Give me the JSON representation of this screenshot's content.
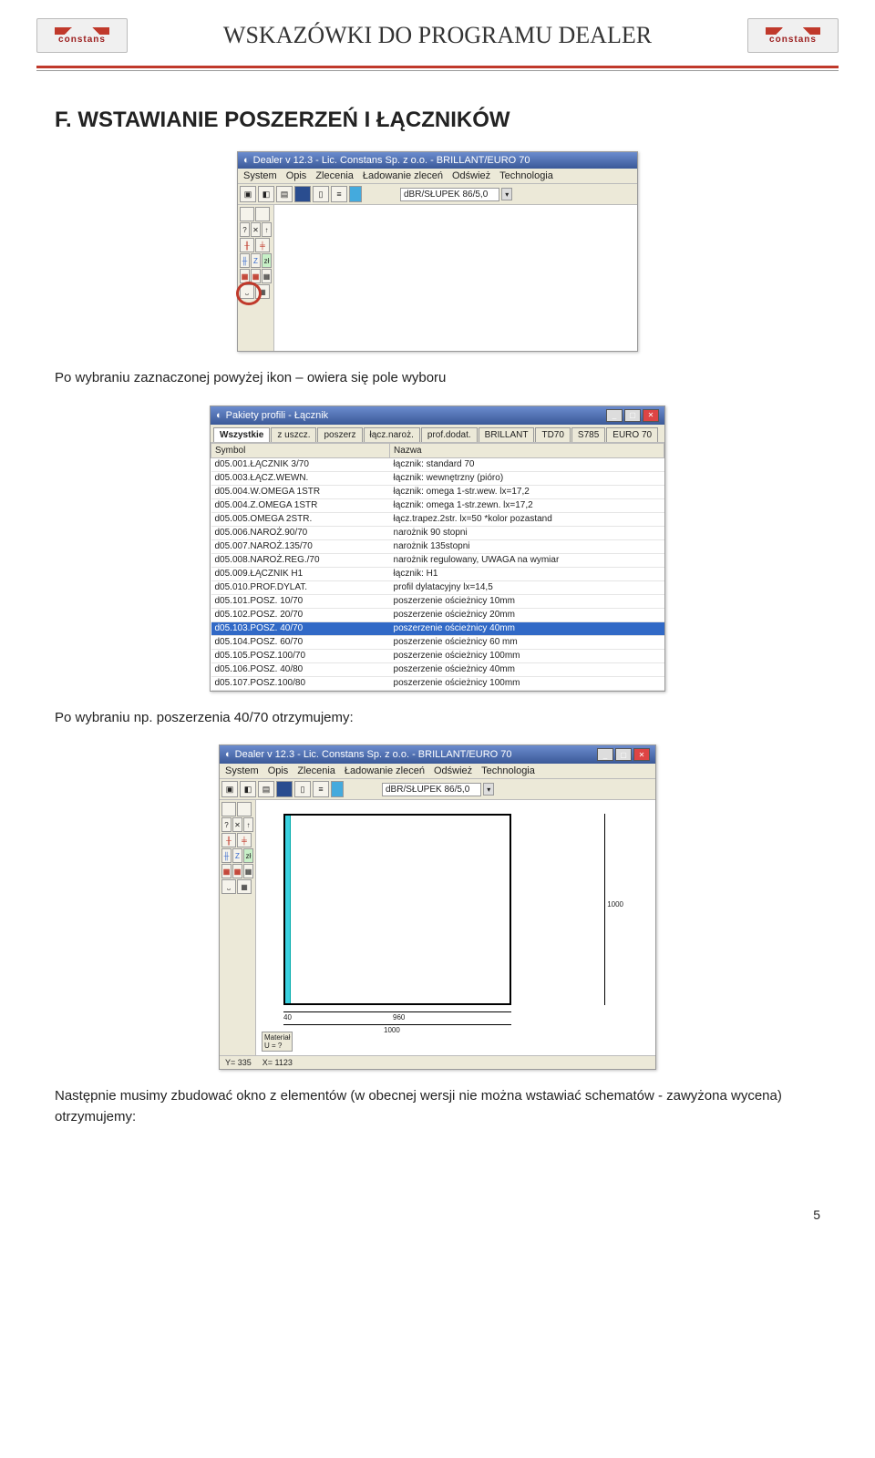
{
  "doc": {
    "header_title": "WSKAZÓWKI DO PROGRAMU DEALER",
    "logo_text": "constans"
  },
  "section": {
    "heading": "F.  WSTAWIANIE POSZERZEŃ I ŁĄCZNIKÓW",
    "para1": "Po wybraniu zaznaczonej powyżej ikon – owiera się pole wyboru",
    "para2": "Po wybraniu np. poszerzenia 40/70 otrzymujemy:",
    "para3": "Następnie musimy zbudować okno z elementów (w obecnej wersji nie można wstawiać schematów - zawyżona wycena) otrzymujemy:"
  },
  "ss_title": "Dealer v 12.3 - Lic. Constans  Sp. z o.o. - BRILLANT/EURO 70",
  "ss_menu": [
    "System",
    "Opis",
    "Zlecenia",
    "Ładowanie zleceń",
    "Odśwież",
    "Technologia"
  ],
  "ss_select": "dBR/SŁUPEK 86/5,0",
  "ss2_title": "Pakiety profili - Łącznik",
  "ss2_tabs": [
    "Wszystkie",
    "z uszcz.",
    "poszerz",
    "łącz.naroż.",
    "prof.dodat.",
    "BRILLANT",
    "TD70",
    "S785",
    "EURO 70"
  ],
  "ss2_headers": [
    "Symbol",
    "Nazwa"
  ],
  "ss2_rows": [
    {
      "sym": "d05.001.ŁĄCZNIK 3/70",
      "naz": "łącznik: standard 70"
    },
    {
      "sym": "d05.003.ŁĄCZ.WEWN.",
      "naz": "łącznik: wewnętrzny (pióro)"
    },
    {
      "sym": "d05.004.W.OMEGA 1STR",
      "naz": "łącznik: omega 1-str.wew. lx=17,2"
    },
    {
      "sym": "d05.004.Z.OMEGA 1STR",
      "naz": "łącznik: omega 1-str.zewn. lx=17,2"
    },
    {
      "sym": "d05.005.OMEGA 2STR.",
      "naz": "łącz.trapez.2str. lx=50 *kolor pozastand"
    },
    {
      "sym": "d05.006.NAROŻ.90/70",
      "naz": "narożnik 90 stopni"
    },
    {
      "sym": "d05.007.NAROŻ.135/70",
      "naz": "narożnik 135stopni"
    },
    {
      "sym": "d05.008.NAROŻ.REG./70",
      "naz": "narożnik regulowany, UWAGA na wymiar"
    },
    {
      "sym": "d05.009.ŁĄCZNIK H1",
      "naz": "łącznik: H1"
    },
    {
      "sym": "d05.010.PROF.DYLAT.",
      "naz": "profil dylatacyjny lx=14,5"
    },
    {
      "sym": "d05.101.POSZ. 10/70",
      "naz": "poszerzenie ościeżnicy 10mm"
    },
    {
      "sym": "d05.102.POSZ. 20/70",
      "naz": "poszerzenie ościeżnicy 20mm"
    },
    {
      "sym": "d05.103.POSZ. 40/70",
      "naz": "poszerzenie ościeżnicy 40mm",
      "sel": true
    },
    {
      "sym": "d05.104.POSZ. 60/70",
      "naz": "poszerzenie ościeżnicy 60 mm"
    },
    {
      "sym": "d05.105.POSZ.100/70",
      "naz": "poszerzenie ościeżnicy 100mm"
    },
    {
      "sym": "d05.106.POSZ. 40/80",
      "naz": "poszerzenie ościeżnicy 40mm"
    },
    {
      "sym": "d05.107.POSZ.100/80",
      "naz": "poszerzenie ościeżnicy 100mm"
    }
  ],
  "ss3": {
    "y_label": "Y=  335",
    "x_label": "X= 1123",
    "material": "Materiał\nU = ?",
    "dim_left_bot": "40",
    "dim_mid_bot": "960",
    "dim_full_bot": "1000",
    "dim_right": "1000"
  },
  "page_number": "5"
}
